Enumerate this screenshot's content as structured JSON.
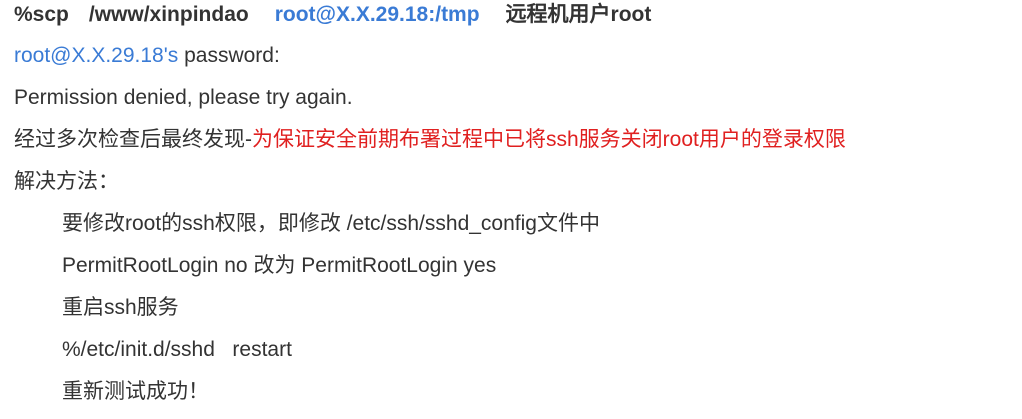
{
  "colors": {
    "text": "#333333",
    "link_blue": "#3a7bd5",
    "highlight_red": "#e02020"
  },
  "heading": {
    "cmd": "%scp",
    "path": "/www/xinpindao",
    "target": "root@X.X.29.18:/tmp",
    "note": "远程机用户root"
  },
  "prompt": {
    "user_host": "root@X.X.29.18's",
    "word": "password:"
  },
  "error": "Permission denied, please try again.",
  "finding": {
    "prefix": "经过多次检查后最终发现-",
    "cause": "为保证安全前期布署过程中已将ssh服务关闭root用户的登录权限"
  },
  "solution": {
    "title": "解决方法：",
    "steps": [
      "要修改root的ssh权限，即修改 /etc/ssh/sshd_config文件中",
      "PermitRootLogin no 改为 PermitRootLogin yes",
      "重启ssh服务",
      "%/etc/init.d/sshd   restart",
      "重新测试成功！"
    ]
  }
}
